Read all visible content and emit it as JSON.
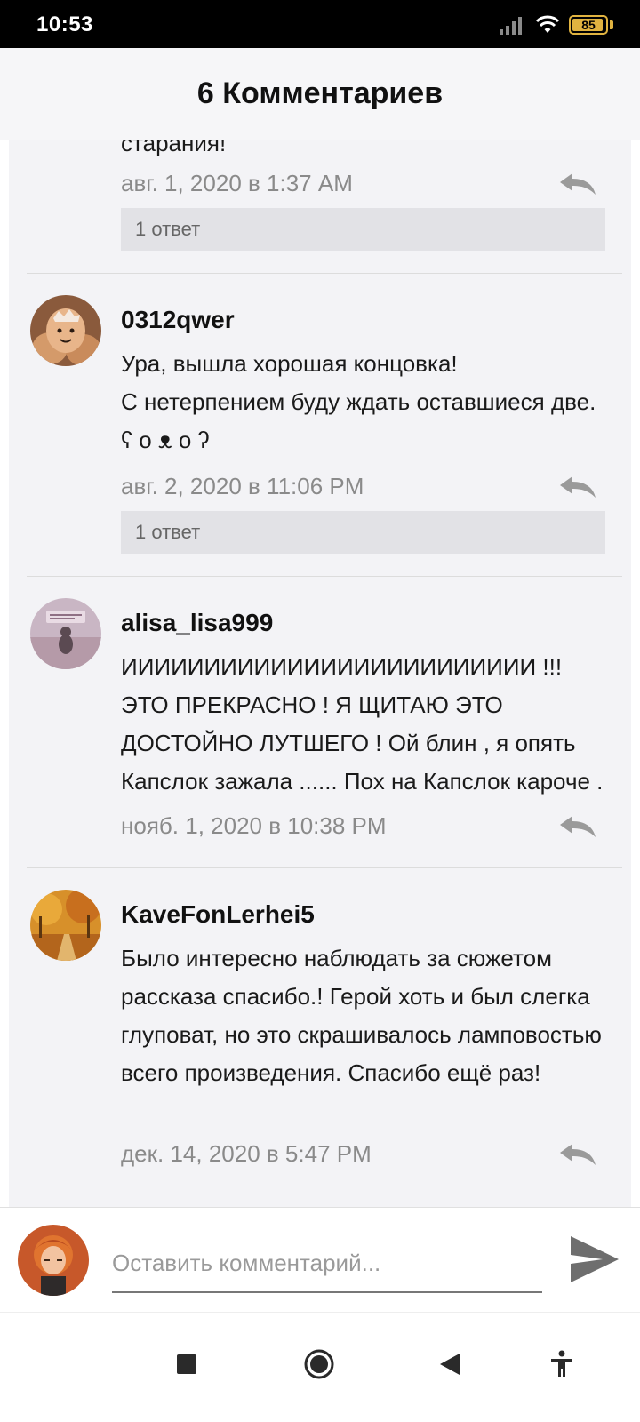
{
  "status_bar": {
    "time": "10:53",
    "battery": "85",
    "icons": [
      "signal-icon",
      "wifi-icon",
      "battery-icon"
    ]
  },
  "header": {
    "title": "6 Комментариев"
  },
  "comments": [
    {
      "text_tail": "старания!",
      "date": "авг. 1, 2020 в 1:37 AM",
      "replies_label": "1 ответ"
    },
    {
      "username": "0312qwer",
      "text": "Ура, вышла хорошая концовка!\nС нетерпением буду ждать оставшиеся две. ʕ ᴏ ᴥ ᴏ ʔ",
      "date": "авг. 2, 2020 в 11:06 PM",
      "replies_label": "1 ответ"
    },
    {
      "username": "alisa_lisa999",
      "text": "ИИИИИИИИИИИИИИИИИИИИИИИИИ !!! ЭТО ПРЕКРАСНО ! Я ЩИТАЮ ЭТО ДОСТОЙНО ЛУТШЕГО ! Ой  блин , я опять Капслок зажала ...... Пох на Капслок кароче .",
      "date": "нояб. 1, 2020 в 10:38 PM"
    },
    {
      "username": "KaveFonLerhei5",
      "text": "Было интересно наблюдать за сюжетом рассказа спасибо.! Герой хоть и был слегка глуповат, но это скрашивалось ламповостью всего произведения. Спасибо ещё раз!",
      "date": "дек. 14, 2020 в 5:47 PM"
    }
  ],
  "comment_input": {
    "placeholder": "Оставить комментарий..."
  },
  "colors": {
    "list_bg": "#f3f3f6",
    "date_gray": "#8a8a8a",
    "replies_bg": "#e2e2e6",
    "battery": "#e0b340"
  }
}
